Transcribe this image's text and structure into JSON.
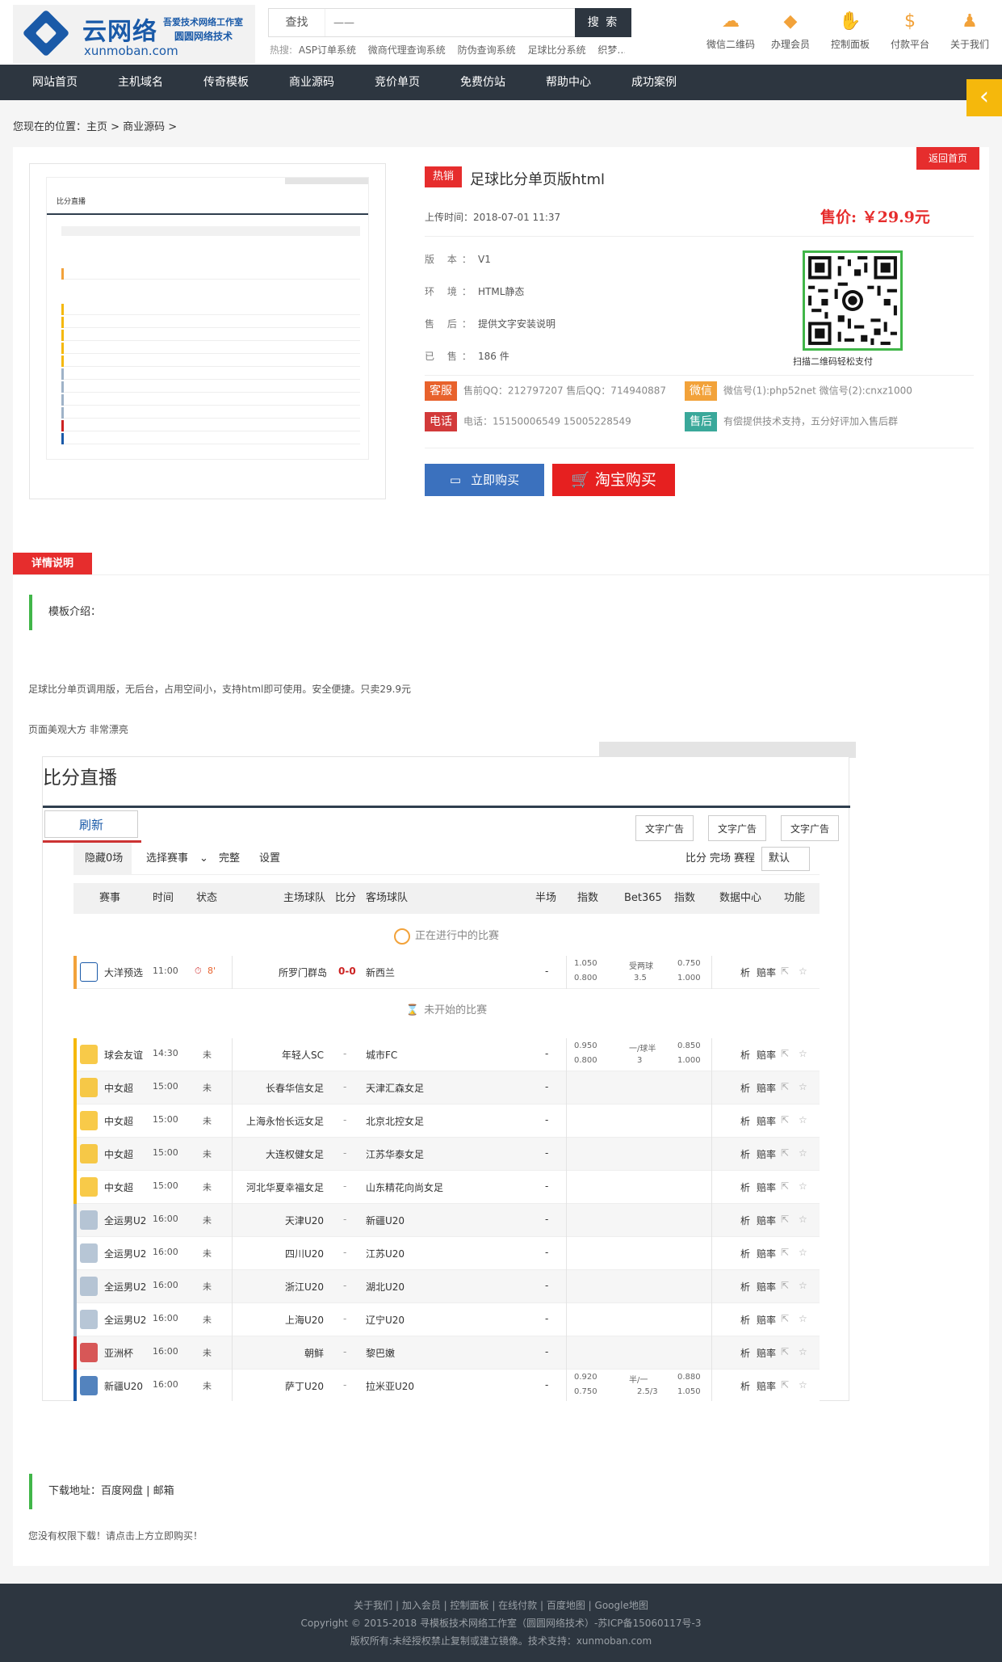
{
  "header": {
    "logo": {
      "name": "云网络",
      "tag1": "吾爱技术网络工作室",
      "tag2": "圆圆网络技术",
      "url": "xunmoban.com"
    },
    "search": {
      "label": "查找",
      "placeholder": "——",
      "button": "搜 索"
    },
    "hot": {
      "label": "热搜:",
      "items": [
        "ASP订单系统",
        "微商代理查询系统",
        "防伪查询系统",
        "足球比分系统",
        "织梦…"
      ]
    },
    "tools": [
      {
        "label": "微信二维码",
        "icon": "wechat-icon"
      },
      {
        "label": "办理会员",
        "icon": "diamond-icon"
      },
      {
        "label": "控制面板",
        "icon": "handshake-icon"
      },
      {
        "label": "付款平台",
        "icon": "money-bag-icon"
      },
      {
        "label": "关于我们",
        "icon": "team-icon"
      }
    ]
  },
  "nav": [
    "网站首页",
    "主机域名",
    "传奇模板",
    "商业源码",
    "竞价单页",
    "免费仿站",
    "帮助中心",
    "成功案例"
  ],
  "breadcrumb": "您现在的位置：主页 > 商业源码 >",
  "product": {
    "back": "返回首页",
    "hot_tag": "热销",
    "title": "足球比分单页版html",
    "upload": "上传时间：2018-07-01 11:37",
    "price": "售价: ￥29.9元",
    "attrs": [
      {
        "k": "版 本：",
        "v": "V1"
      },
      {
        "k": "环 境：",
        "v": "HTML静态"
      },
      {
        "k": "售 后：",
        "v": "提供文字安装说明"
      },
      {
        "k": "已 售：",
        "v": "186 件"
      }
    ],
    "qr_caption": "扫描二维码轻松支付",
    "services": [
      {
        "badge": "客服",
        "text": "售前QQ：212797207 售后QQ：714940887",
        "color": "#e8622c"
      },
      {
        "badge": "微信",
        "text": "微信号(1):php52net 微信号(2):cnxz1000",
        "color": "#f2a23a"
      },
      {
        "badge": "电话",
        "text": "电话：15150006549 15005228549",
        "color": "#d23a3a"
      },
      {
        "badge": "售后",
        "text": "有偿提供技术支持，五分好评加入售后群",
        "color": "#3aa89a"
      }
    ],
    "buy": "立即购买",
    "taobao": "淘宝购买"
  },
  "detail": {
    "section": "详情说明",
    "sub": "模板介绍：",
    "p1": "足球比分单页调用版，无后台，占用空间小，支持html即可使用。安全便捷。只卖29.9元",
    "p2": "页面美观大方 非常漂亮"
  },
  "preview": {
    "title": "比分直播",
    "refresh": "刷新",
    "ads": [
      "文字广告",
      "文字广告",
      "文字广告"
    ],
    "controls": {
      "hide": "隐藏0场",
      "select": "选择赛事",
      "done": "完整",
      "settings": "设置",
      "r1": "比分",
      "r2": "完场",
      "r3": "赛程",
      "default": "默认"
    },
    "thead": [
      "赛事",
      "时间",
      "状态",
      "主场球队",
      "比分",
      "客场球队",
      "半场",
      "指数",
      "Bet365",
      "指数",
      "数据中心",
      "功能"
    ],
    "group_live": "正在进行中的比赛",
    "group_upcoming": "未开始的比赛",
    "live": {
      "league": "大洋预选",
      "time": "11:00",
      "status": "8'",
      "home": "所罗门群岛",
      "score": "0-0",
      "away": "新西兰",
      "half": "-",
      "o1": [
        "1.050",
        "0.800"
      ],
      "o2": [
        "受两球",
        "3.5"
      ],
      "o3": [
        "0.750",
        "1.000"
      ],
      "an": "析",
      "pv": "赔率"
    },
    "rows": [
      {
        "league": "球会友谊",
        "time": "14:30",
        "status": "未",
        "home": "年轻人SC",
        "score": "-",
        "away": "城市FC",
        "half": "-",
        "o1": [
          "0.950",
          "0.800"
        ],
        "o2": [
          "一/球半",
          "3"
        ],
        "o3": [
          "0.850",
          "1.000"
        ],
        "color": "#f5b80c"
      },
      {
        "league": "中女超",
        "time": "15:00",
        "status": "未",
        "home": "长春华信女足",
        "score": "-",
        "away": "天津汇森女足",
        "half": "-",
        "color": "#f5b80c"
      },
      {
        "league": "中女超",
        "time": "15:00",
        "status": "未",
        "home": "上海永怡长远女足",
        "score": "-",
        "away": "北京北控女足",
        "half": "-",
        "color": "#f5b80c"
      },
      {
        "league": "中女超",
        "time": "15:00",
        "status": "未",
        "home": "大连权健女足",
        "score": "-",
        "away": "江苏华泰女足",
        "half": "-",
        "color": "#f5b80c"
      },
      {
        "league": "中女超",
        "time": "15:00",
        "status": "未",
        "home": "河北华夏幸福女足",
        "score": "-",
        "away": "山东精花向尚女足",
        "half": "-",
        "color": "#f5b80c"
      },
      {
        "league": "全运男U2",
        "time": "16:00",
        "status": "未",
        "home": "天津U20",
        "score": "-",
        "away": "新疆U20",
        "half": "-",
        "color": "#9fb3c8"
      },
      {
        "league": "全运男U2",
        "time": "16:00",
        "status": "未",
        "home": "四川U20",
        "score": "-",
        "away": "江苏U20",
        "half": "-",
        "color": "#9fb3c8"
      },
      {
        "league": "全运男U2",
        "time": "16:00",
        "status": "未",
        "home": "浙江U20",
        "score": "-",
        "away": "湖北U20",
        "half": "-",
        "color": "#9fb3c8"
      },
      {
        "league": "全运男U2",
        "time": "16:00",
        "status": "未",
        "home": "上海U20",
        "score": "-",
        "away": "辽宁U20",
        "half": "-",
        "color": "#9fb3c8"
      },
      {
        "league": "亚洲杯",
        "time": "16:00",
        "status": "未",
        "home": "朝鲜",
        "score": "-",
        "away": "黎巴嫩",
        "half": "-",
        "color": "#c22"
      },
      {
        "league": "新疆U20",
        "time": "16:00",
        "status": "未",
        "home": "萨丁U20",
        "score": "-",
        "away": "拉米亚U20",
        "half": "-",
        "o1": [
          "0.920",
          "0.750"
        ],
        "o2": [
          "半/一",
          "2.5/3"
        ],
        "o3": [
          "0.880",
          "1.050"
        ],
        "color": "#1a5aa8"
      }
    ],
    "analysis": "析",
    "odds_label": "赔率"
  },
  "download": {
    "label": "下载地址：百度网盘 | 邮箱",
    "note": "您没有权限下载！请点击上方立即购买！"
  },
  "footer": {
    "links": "关于我们 | 加入会员 | 控制面板 | 在线付款 | 百度地图 | Google地图",
    "copyright": "Copyright © 2015-2018 寻模板技术网络工作室（圆圆网络技术）-苏ICP备15060117号-3",
    "rights": "版权所有:未经授权禁止复制或建立镜像。技术支持：xunmoban.com"
  }
}
